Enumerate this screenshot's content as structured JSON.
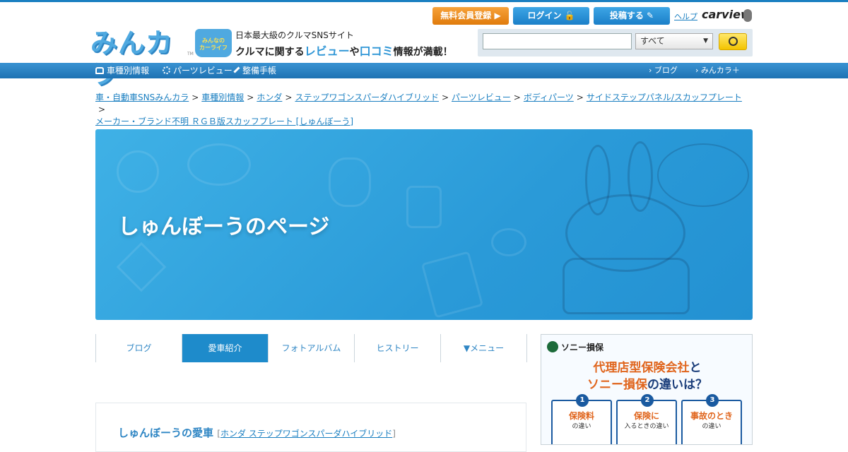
{
  "header": {
    "logo": "みんカラ",
    "logo_tm": "TM",
    "carlife_line1": "みんなの",
    "carlife_line2": "カーライフ",
    "tagline1": "日本最大級のクルマSNSサイト",
    "tagline2_a": "クルマに関する",
    "tagline2_review": "レビュー",
    "tagline2_ya": "や",
    "tagline2_kuchikomi": "口コミ",
    "tagline2_b": "情報が満載！",
    "register_label": "無料会員登録 ▶",
    "login_label": "ログイン 🔓",
    "post_label": "投稿する ✎",
    "help_label": "ヘルプ",
    "carview_label": "carview",
    "search_placeholder": "",
    "search_select": "すべて",
    "colors": {
      "accent": "#1e8bcb",
      "orange": "#e07b0c",
      "yellow": "#f3c400"
    }
  },
  "nav": {
    "car_info": "車種別情報",
    "parts_review": "パーツレビュー",
    "maintenance": "整備手帳",
    "blog": "ブログ",
    "minkara_plus": "みんカラ＋"
  },
  "breadcrumb": [
    "車・自動車SNSみんカラ",
    "車種別情報",
    "ホンダ",
    "ステップワゴンスパーダハイブリッド",
    "パーツレビュー",
    "ボディパーツ",
    "サイドステップパネル/スカッフプレート",
    "メーカー・ブランド不明 ＲＧＢ版スカッフプレート [しゅんぼーう]"
  ],
  "banner": {
    "title": "しゅんぼーうのページ"
  },
  "tabs": [
    {
      "label": "ブログ",
      "active": false
    },
    {
      "label": "愛車紹介",
      "active": true
    },
    {
      "label": "フォトアルバム",
      "active": false
    },
    {
      "label": "ヒストリー",
      "active": false
    },
    {
      "label": "▼メニュー",
      "active": false
    }
  ],
  "ad": {
    "logo": "ソニー損保",
    "head1_a": "代理店型保険会社",
    "head1_b": "と",
    "head2_a": "ソニー損保",
    "head2_b": "の違いは？",
    "boxes": [
      {
        "num": "1",
        "t1": "保険料",
        "t2": "の違い"
      },
      {
        "num": "2",
        "t1": "保険に",
        "t2": "入るときの違い"
      },
      {
        "num": "3",
        "t1": "事故のとき",
        "t2": "の違い"
      }
    ]
  },
  "card": {
    "title": "しゅんぼーうの愛車",
    "car_link": "ホンダ ステップワゴンスパーダハイブリッド"
  }
}
